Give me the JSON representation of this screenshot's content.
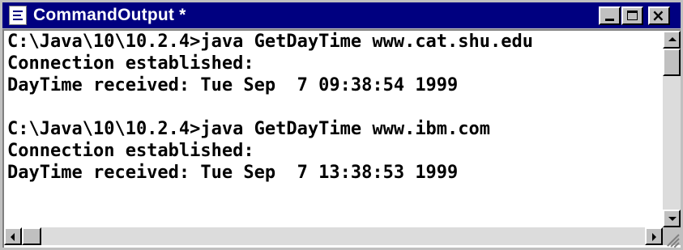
{
  "window": {
    "title": "CommandOutput *",
    "icon": "document-icon",
    "controls": {
      "minimize": "minimize",
      "maximize": "maximize",
      "close": "×"
    }
  },
  "console": {
    "lines": [
      "C:\\Java\\10\\10.2.4>java GetDayTime www.cat.shu.edu",
      "Connection established:",
      "DayTime received: Tue Sep  7 09:38:54 1999",
      "",
      "C:\\Java\\10\\10.2.4>java GetDayTime www.ibm.com",
      "Connection established:",
      "DayTime received: Tue Sep  7 13:38:53 1999",
      ""
    ]
  },
  "colors": {
    "titlebar": "#000080",
    "title_text": "#ffffff",
    "chrome": "#c0c0c0",
    "console_bg": "#ffffff",
    "console_text": "#000000"
  }
}
